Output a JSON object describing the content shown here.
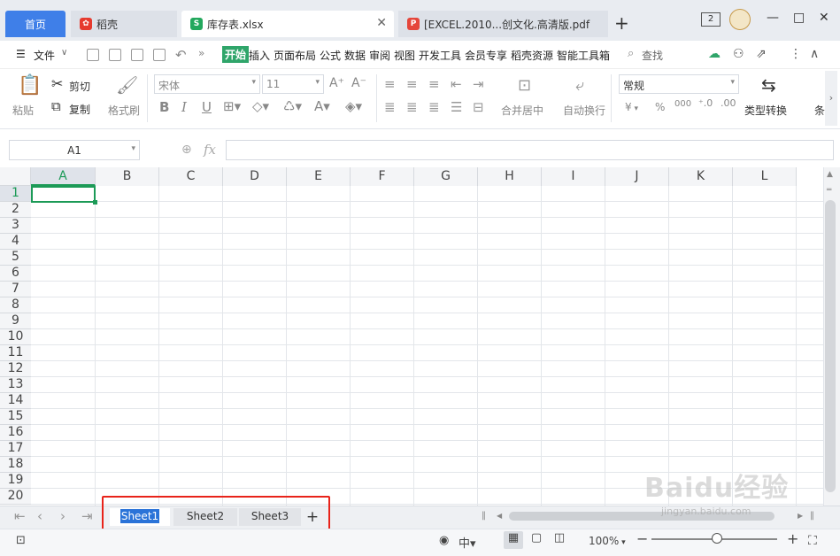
{
  "tabs": {
    "home": "首页",
    "daoke": "稻壳",
    "workbook": "库存表.xlsx",
    "pdf": "[EXCEL.2010...创文化.高清版.pdf",
    "new_tab": "+"
  },
  "window": {
    "badge": "2",
    "minimize": "—",
    "maximize": "□",
    "close": "✕"
  },
  "menu": {
    "file": "文件",
    "items": [
      "开始",
      "插入",
      "页面布局",
      "公式",
      "数据",
      "审阅",
      "视图",
      "开发工具",
      "会员专享",
      "稻壳资源",
      "智能工具箱"
    ],
    "search": "查找"
  },
  "toolbar": {
    "paste": "粘贴",
    "cut": "剪切",
    "copy": "复制",
    "format_painter": "格式刷",
    "font_name": "宋体",
    "font_size": "11",
    "merge_center": "合并居中",
    "wrap_text": "自动换行",
    "number_format": "常规",
    "type_convert": "类型转换",
    "currency": "¥",
    "percent": "%",
    "thousands": "000",
    "more_label": "条"
  },
  "formula": {
    "cell_ref": "A1",
    "fx": "fx",
    "value": ""
  },
  "grid": {
    "columns": [
      "A",
      "B",
      "C",
      "D",
      "E",
      "F",
      "G",
      "H",
      "I",
      "J",
      "K",
      "L"
    ],
    "rows": [
      "1",
      "2",
      "3",
      "4",
      "5",
      "6",
      "7",
      "8",
      "9",
      "10",
      "11",
      "12",
      "13",
      "14",
      "15",
      "16",
      "17",
      "18",
      "19",
      "20"
    ],
    "selected_cell": "A1"
  },
  "sheets": {
    "tabs": [
      "Sheet1",
      "Sheet2",
      "Sheet3"
    ],
    "active": "Sheet1",
    "add": "+"
  },
  "status": {
    "zoom": "100%"
  },
  "watermark": {
    "brand": "Baidu经验",
    "url": "jingyan.baidu.com"
  },
  "colors": {
    "accent_green": "#1c9a57",
    "home_tab_blue": "#3f7fe8",
    "annotation_red": "#e8231a",
    "active_sheet_blue": "#2a73d8"
  }
}
